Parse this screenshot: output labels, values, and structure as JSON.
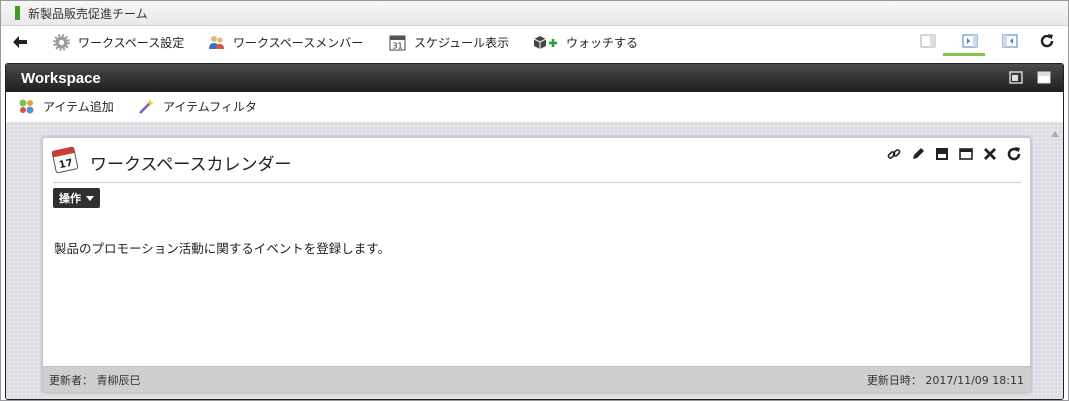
{
  "window": {
    "title": "新製品販売促進チーム"
  },
  "toolbar": {
    "back_icon": "arrow-left-icon",
    "settings_label": "ワークスペース設定",
    "members_label": "ワークスペースメンバー",
    "schedule_label": "スケジュール表示",
    "schedule_day": "31",
    "watch_label": "ウォッチする",
    "right_icons": [
      "layout-single-icon",
      "layout-right-panel-icon",
      "layout-left-panel-icon",
      "refresh-icon"
    ]
  },
  "workspace": {
    "title": "Workspace",
    "add_item_label": "アイテム追加",
    "item_filter_label": "アイテムフィルタ"
  },
  "portlet": {
    "title": "ワークスペースカレンダー",
    "calendar_day": "17",
    "operation_label": "操作",
    "description": "製品のプロモーション活動に関するイベントを登録します。",
    "updated_by_label": "更新者：",
    "updated_by": "青柳辰巳",
    "updated_at_label": "更新日時：",
    "updated_at": "2017/11/09 18:11",
    "tools": [
      "link-icon",
      "edit-pencil-icon",
      "minimize-icon",
      "maximize-icon",
      "close-icon",
      "refresh-icon"
    ]
  },
  "colors": {
    "accent_green": "#8ac34a",
    "header_dark": "#1f1f1f",
    "marker_green": "#3f9a26"
  }
}
